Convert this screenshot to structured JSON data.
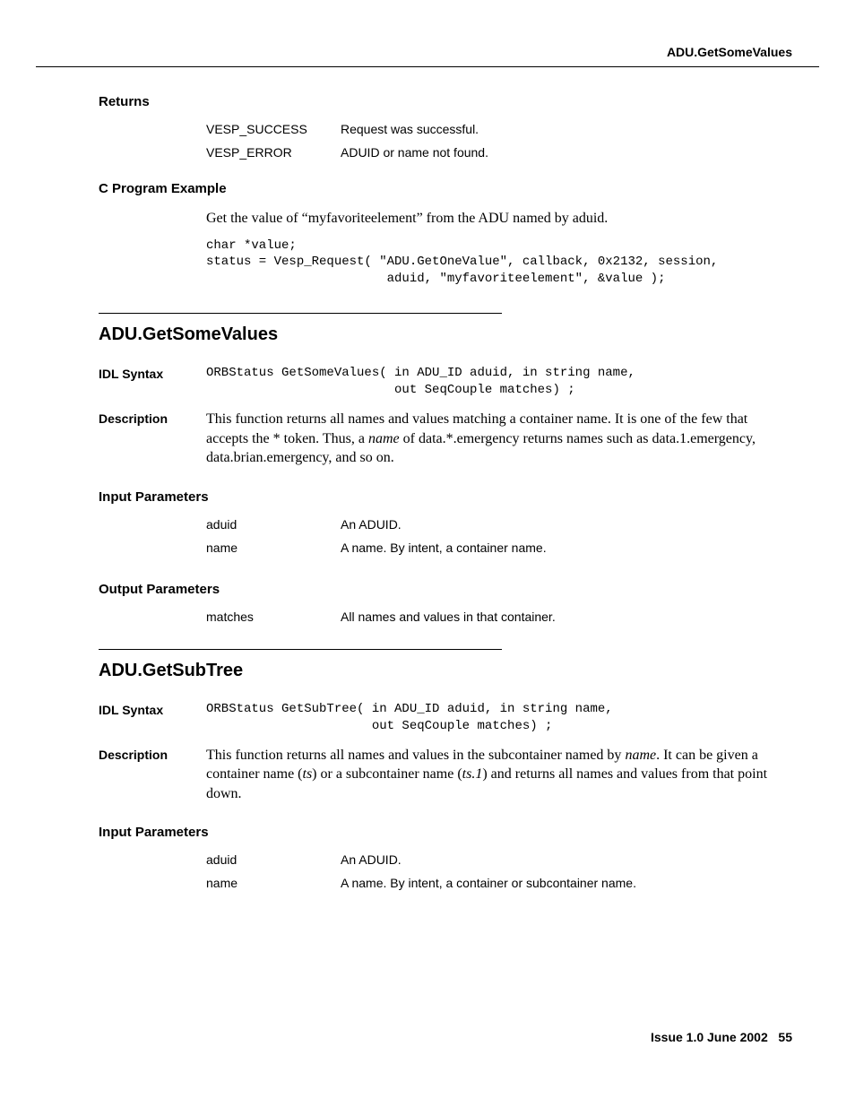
{
  "header": {
    "title": "ADU.GetSomeValues"
  },
  "returns": {
    "heading": "Returns",
    "rows": [
      {
        "key": "VESP_SUCCESS",
        "val": "Request was successful."
      },
      {
        "key": "VESP_ERROR",
        "val": "ADUID or name not found."
      }
    ]
  },
  "cexample": {
    "heading": "C Program Example",
    "intro": "Get the value of “myfavoriteelement” from the ADU named by aduid.",
    "code": "char *value;\nstatus = Vesp_Request( \"ADU.GetOneValue\", callback, 0x2132, session,\n                        aduid, \"myfavoriteelement\", &value );"
  },
  "getsome": {
    "title": "ADU.GetSomeValues",
    "idl_label": "IDL Syntax",
    "idl_code": "ORBStatus GetSomeValues( in ADU_ID aduid, in string name,\n                         out SeqCouple matches) ;",
    "desc_label": "Description",
    "desc_pre": "This function returns all names and values matching a container name. It is one of the few that accepts the * token. Thus, a ",
    "desc_em": "name",
    "desc_post": " of data.*.emergency returns names such as data.1.emergency, data.brian.emergency, and so on.",
    "input_heading": "Input Parameters",
    "input_rows": [
      {
        "key": "aduid",
        "val": "An ADUID."
      },
      {
        "key": "name",
        "val": "A name. By intent, a container name."
      }
    ],
    "output_heading": "Output Parameters",
    "output_rows": [
      {
        "key": "matches",
        "val": "All names and values in that container."
      }
    ]
  },
  "getsubtree": {
    "title": "ADU.GetSubTree",
    "idl_label": "IDL Syntax",
    "idl_code": "ORBStatus GetSubTree( in ADU_ID aduid, in string name,\n                      out SeqCouple matches) ;",
    "desc_label": "Description",
    "desc_seg1": "This function returns all names and values in the subcontainer named by ",
    "desc_em1": "name",
    "desc_seg2": ". It can be given a container name (",
    "desc_em2": "ts",
    "desc_seg3": ") or a subcontainer name (",
    "desc_em3": "ts.1",
    "desc_seg4": ") and returns all names and values from that point down.",
    "input_heading": "Input Parameters",
    "input_rows": [
      {
        "key": "aduid",
        "val": "An ADUID."
      },
      {
        "key": "name",
        "val": "A name. By intent, a container or subcontainer name."
      }
    ]
  },
  "footer": {
    "issue": "Issue 1.0   June 2002",
    "page": "55"
  }
}
